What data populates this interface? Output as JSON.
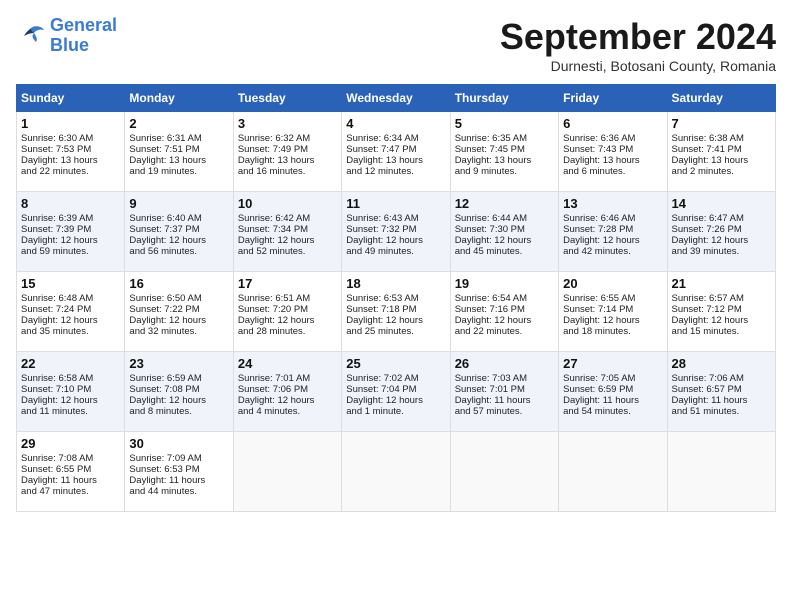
{
  "header": {
    "logo_line1": "General",
    "logo_line2": "Blue",
    "month_title": "September 2024",
    "subtitle": "Durnesti, Botosani County, Romania"
  },
  "days_of_week": [
    "Sunday",
    "Monday",
    "Tuesday",
    "Wednesday",
    "Thursday",
    "Friday",
    "Saturday"
  ],
  "weeks": [
    [
      {
        "day": "1",
        "lines": [
          "Sunrise: 6:30 AM",
          "Sunset: 7:53 PM",
          "Daylight: 13 hours",
          "and 22 minutes."
        ]
      },
      {
        "day": "2",
        "lines": [
          "Sunrise: 6:31 AM",
          "Sunset: 7:51 PM",
          "Daylight: 13 hours",
          "and 19 minutes."
        ]
      },
      {
        "day": "3",
        "lines": [
          "Sunrise: 6:32 AM",
          "Sunset: 7:49 PM",
          "Daylight: 13 hours",
          "and 16 minutes."
        ]
      },
      {
        "day": "4",
        "lines": [
          "Sunrise: 6:34 AM",
          "Sunset: 7:47 PM",
          "Daylight: 13 hours",
          "and 12 minutes."
        ]
      },
      {
        "day": "5",
        "lines": [
          "Sunrise: 6:35 AM",
          "Sunset: 7:45 PM",
          "Daylight: 13 hours",
          "and 9 minutes."
        ]
      },
      {
        "day": "6",
        "lines": [
          "Sunrise: 6:36 AM",
          "Sunset: 7:43 PM",
          "Daylight: 13 hours",
          "and 6 minutes."
        ]
      },
      {
        "day": "7",
        "lines": [
          "Sunrise: 6:38 AM",
          "Sunset: 7:41 PM",
          "Daylight: 13 hours",
          "and 2 minutes."
        ]
      }
    ],
    [
      {
        "day": "8",
        "lines": [
          "Sunrise: 6:39 AM",
          "Sunset: 7:39 PM",
          "Daylight: 12 hours",
          "and 59 minutes."
        ]
      },
      {
        "day": "9",
        "lines": [
          "Sunrise: 6:40 AM",
          "Sunset: 7:37 PM",
          "Daylight: 12 hours",
          "and 56 minutes."
        ]
      },
      {
        "day": "10",
        "lines": [
          "Sunrise: 6:42 AM",
          "Sunset: 7:34 PM",
          "Daylight: 12 hours",
          "and 52 minutes."
        ]
      },
      {
        "day": "11",
        "lines": [
          "Sunrise: 6:43 AM",
          "Sunset: 7:32 PM",
          "Daylight: 12 hours",
          "and 49 minutes."
        ]
      },
      {
        "day": "12",
        "lines": [
          "Sunrise: 6:44 AM",
          "Sunset: 7:30 PM",
          "Daylight: 12 hours",
          "and 45 minutes."
        ]
      },
      {
        "day": "13",
        "lines": [
          "Sunrise: 6:46 AM",
          "Sunset: 7:28 PM",
          "Daylight: 12 hours",
          "and 42 minutes."
        ]
      },
      {
        "day": "14",
        "lines": [
          "Sunrise: 6:47 AM",
          "Sunset: 7:26 PM",
          "Daylight: 12 hours",
          "and 39 minutes."
        ]
      }
    ],
    [
      {
        "day": "15",
        "lines": [
          "Sunrise: 6:48 AM",
          "Sunset: 7:24 PM",
          "Daylight: 12 hours",
          "and 35 minutes."
        ]
      },
      {
        "day": "16",
        "lines": [
          "Sunrise: 6:50 AM",
          "Sunset: 7:22 PM",
          "Daylight: 12 hours",
          "and 32 minutes."
        ]
      },
      {
        "day": "17",
        "lines": [
          "Sunrise: 6:51 AM",
          "Sunset: 7:20 PM",
          "Daylight: 12 hours",
          "and 28 minutes."
        ]
      },
      {
        "day": "18",
        "lines": [
          "Sunrise: 6:53 AM",
          "Sunset: 7:18 PM",
          "Daylight: 12 hours",
          "and 25 minutes."
        ]
      },
      {
        "day": "19",
        "lines": [
          "Sunrise: 6:54 AM",
          "Sunset: 7:16 PM",
          "Daylight: 12 hours",
          "and 22 minutes."
        ]
      },
      {
        "day": "20",
        "lines": [
          "Sunrise: 6:55 AM",
          "Sunset: 7:14 PM",
          "Daylight: 12 hours",
          "and 18 minutes."
        ]
      },
      {
        "day": "21",
        "lines": [
          "Sunrise: 6:57 AM",
          "Sunset: 7:12 PM",
          "Daylight: 12 hours",
          "and 15 minutes."
        ]
      }
    ],
    [
      {
        "day": "22",
        "lines": [
          "Sunrise: 6:58 AM",
          "Sunset: 7:10 PM",
          "Daylight: 12 hours",
          "and 11 minutes."
        ]
      },
      {
        "day": "23",
        "lines": [
          "Sunrise: 6:59 AM",
          "Sunset: 7:08 PM",
          "Daylight: 12 hours",
          "and 8 minutes."
        ]
      },
      {
        "day": "24",
        "lines": [
          "Sunrise: 7:01 AM",
          "Sunset: 7:06 PM",
          "Daylight: 12 hours",
          "and 4 minutes."
        ]
      },
      {
        "day": "25",
        "lines": [
          "Sunrise: 7:02 AM",
          "Sunset: 7:04 PM",
          "Daylight: 12 hours",
          "and 1 minute."
        ]
      },
      {
        "day": "26",
        "lines": [
          "Sunrise: 7:03 AM",
          "Sunset: 7:01 PM",
          "Daylight: 11 hours",
          "and 57 minutes."
        ]
      },
      {
        "day": "27",
        "lines": [
          "Sunrise: 7:05 AM",
          "Sunset: 6:59 PM",
          "Daylight: 11 hours",
          "and 54 minutes."
        ]
      },
      {
        "day": "28",
        "lines": [
          "Sunrise: 7:06 AM",
          "Sunset: 6:57 PM",
          "Daylight: 11 hours",
          "and 51 minutes."
        ]
      }
    ],
    [
      {
        "day": "29",
        "lines": [
          "Sunrise: 7:08 AM",
          "Sunset: 6:55 PM",
          "Daylight: 11 hours",
          "and 47 minutes."
        ]
      },
      {
        "day": "30",
        "lines": [
          "Sunrise: 7:09 AM",
          "Sunset: 6:53 PM",
          "Daylight: 11 hours",
          "and 44 minutes."
        ]
      },
      {
        "day": "",
        "lines": []
      },
      {
        "day": "",
        "lines": []
      },
      {
        "day": "",
        "lines": []
      },
      {
        "day": "",
        "lines": []
      },
      {
        "day": "",
        "lines": []
      }
    ]
  ]
}
